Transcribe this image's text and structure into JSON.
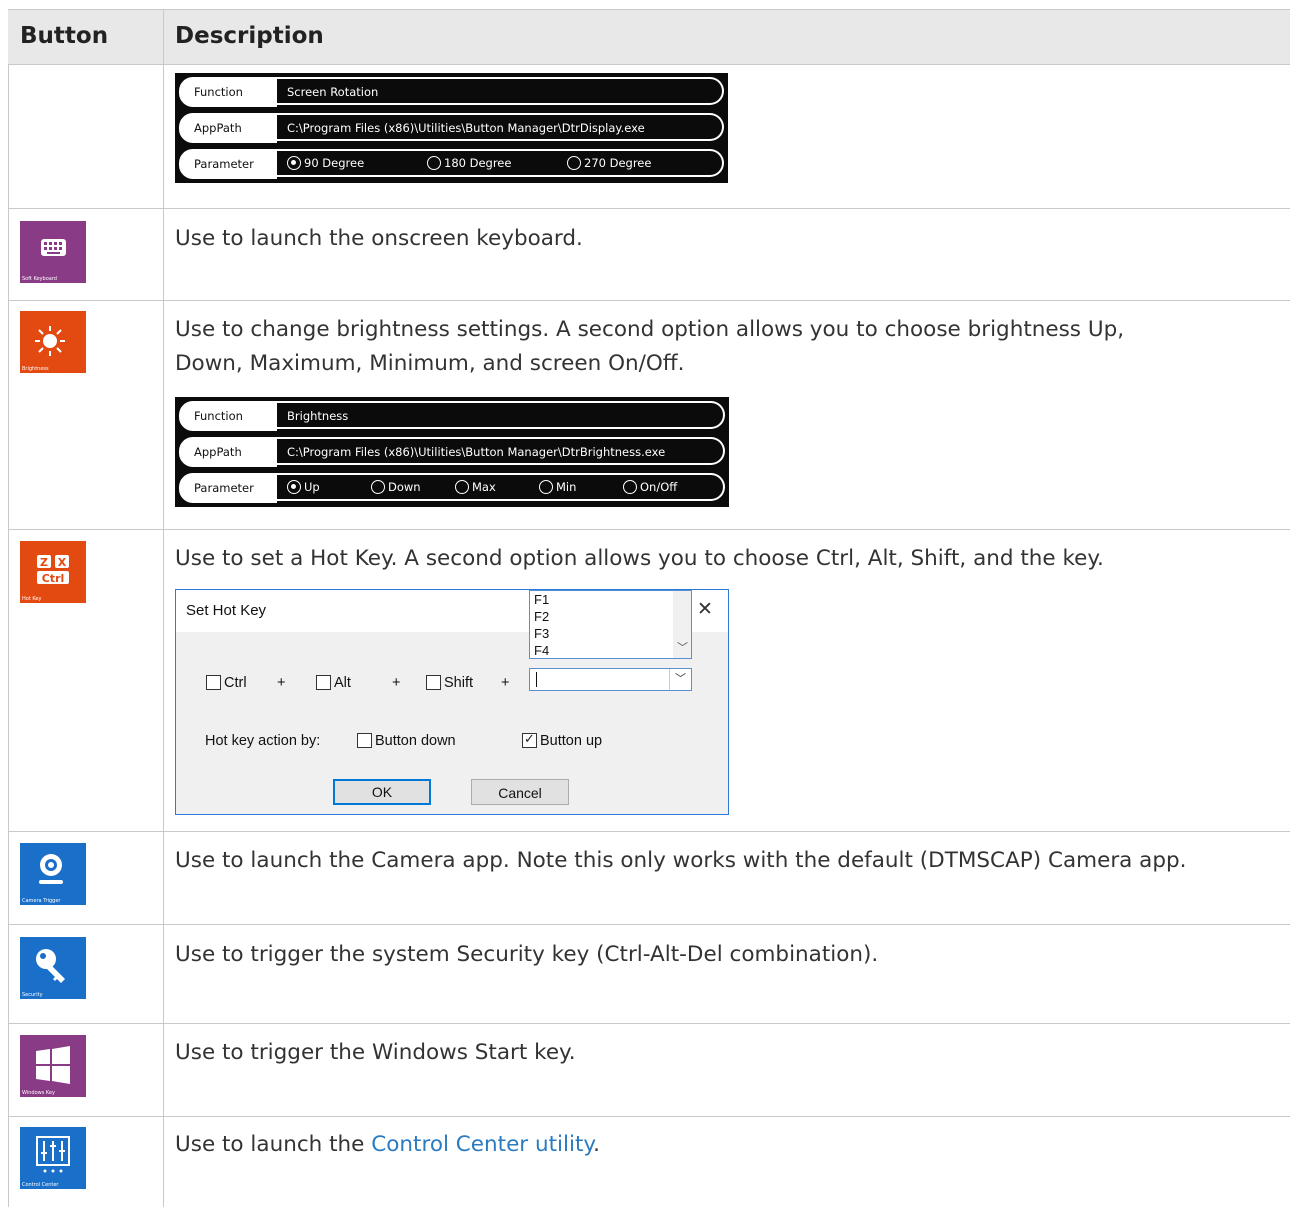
{
  "header": {
    "col_button": "Button",
    "col_description": "Description"
  },
  "rotation_panel": {
    "function_label": "Function",
    "function_value": "Screen Rotation",
    "apppath_label": "AppPath",
    "apppath_value": "C:\\Program Files (x86)\\Utilities\\Button Manager\\DtrDisplay.exe",
    "parameter_label": "Parameter",
    "options": [
      "90 Degree",
      "180 Degree",
      "270 Degree"
    ],
    "selected": "90 Degree"
  },
  "rows": {
    "soft_keyboard": {
      "tile_caption": "Soft Keyboard",
      "tile_color": "#8a3b85",
      "description": "Use to launch the onscreen keyboard."
    },
    "brightness": {
      "tile_caption": "Brightness",
      "tile_color": "#e34a12",
      "description_line1": "Use to change brightness settings. A second option allows you to choose brightness Up,",
      "description_line2": "Down, Maximum, Minimum, and screen On/Off."
    },
    "hot_key": {
      "tile_caption": "Hot Key",
      "tile_color": "#e34a12",
      "tile_keys": [
        "Z",
        "X",
        "Ctrl"
      ],
      "description": "Use to set a Hot Key. A second option allows you to choose Ctrl, Alt, Shift, and the key."
    },
    "camera": {
      "tile_caption": "Camera Trigger",
      "tile_color": "#1a6fc9",
      "description": "Use to launch the Camera app. Note this only works with the default (DTMSCAP) Camera app."
    },
    "security": {
      "tile_caption": "Security",
      "tile_color": "#1a6fc9",
      "description": "Use to trigger the system Security key (Ctrl-Alt-Del combination)."
    },
    "windows": {
      "tile_caption": "Windows Key",
      "tile_color": "#8a3b85",
      "description": "Use to trigger the Windows Start key."
    },
    "control_center": {
      "tile_caption": "Control Center",
      "tile_color": "#1a6fc9",
      "description_prefix": "Use to launch the ",
      "link_text": "Control Center utility",
      "description_suffix": "."
    }
  },
  "brightness_panel": {
    "function_label": "Function",
    "function_value": "Brightness",
    "apppath_label": "AppPath",
    "apppath_value": "C:\\Program Files (x86)\\Utilities\\Button Manager\\DtrBrightness.exe",
    "parameter_label": "Parameter",
    "options": [
      "Up",
      "Down",
      "Max",
      "Min",
      "On/Off"
    ],
    "selected": "Up"
  },
  "hotkey_dialog": {
    "title": "Set Hot Key",
    "close_glyph": "✕",
    "modifiers": [
      "Ctrl",
      "Alt",
      "Shift"
    ],
    "plus": "+",
    "key_options": [
      "F1",
      "F2",
      "F3",
      "F4"
    ],
    "key_value": "",
    "action_label": "Hot key action by:",
    "button_down_label": "Button down",
    "button_down_checked": false,
    "button_up_label": "Button up",
    "button_up_checked": true,
    "ok_label": "OK",
    "cancel_label": "Cancel"
  }
}
